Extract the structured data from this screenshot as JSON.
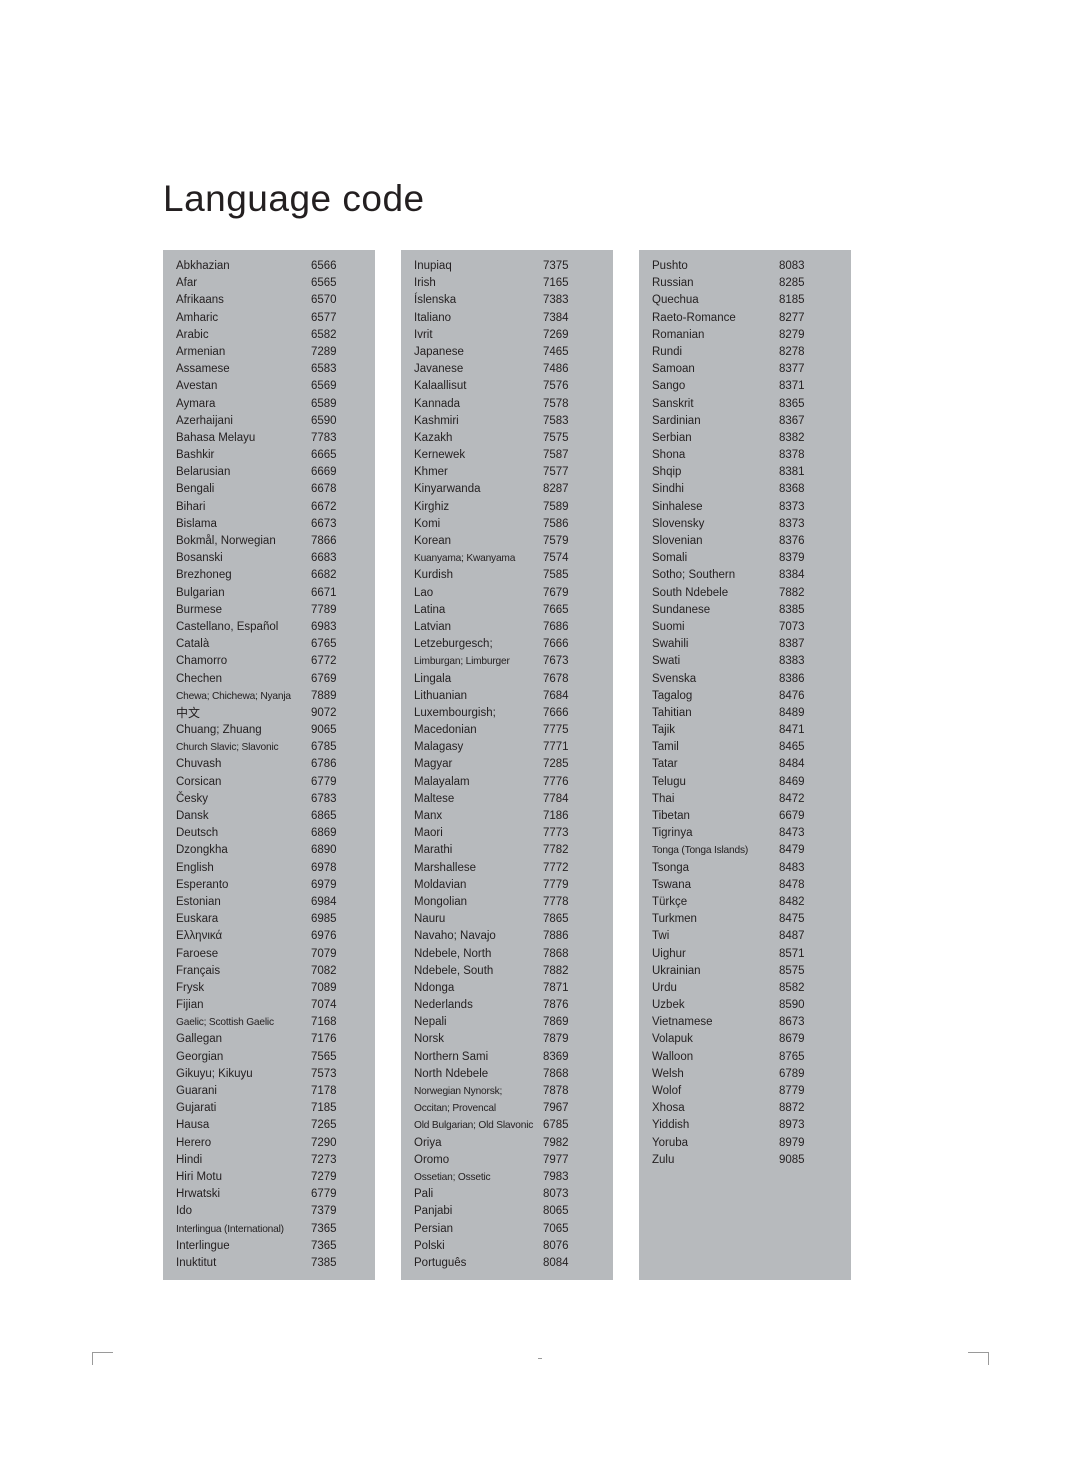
{
  "page": {
    "title": "Language code"
  },
  "columns": [
    {
      "id": "column-1",
      "rows": [
        {
          "lang": "Abkhazian",
          "code": "6566"
        },
        {
          "lang": "Afar",
          "code": "6565"
        },
        {
          "lang": "Afrikaans",
          "code": "6570"
        },
        {
          "lang": "Amharic",
          "code": "6577"
        },
        {
          "lang": "Arabic",
          "code": "6582"
        },
        {
          "lang": "Armenian",
          "code": "7289"
        },
        {
          "lang": "Assamese",
          "code": "6583"
        },
        {
          "lang": "Avestan",
          "code": "6569"
        },
        {
          "lang": "Aymara",
          "code": "6589"
        },
        {
          "lang": "Azerhaijani",
          "code": "6590"
        },
        {
          "lang": "Bahasa Melayu",
          "code": "7783"
        },
        {
          "lang": "Bashkir",
          "code": "6665"
        },
        {
          "lang": "Belarusian",
          "code": "6669"
        },
        {
          "lang": "Bengali",
          "code": "6678"
        },
        {
          "lang": "Bihari",
          "code": "6672"
        },
        {
          "lang": "Bislama",
          "code": "6673"
        },
        {
          "lang": "Bokmål, Norwegian",
          "code": "7866"
        },
        {
          "lang": "Bosanski",
          "code": "6683"
        },
        {
          "lang": "Brezhoneg",
          "code": "6682"
        },
        {
          "lang": "Bulgarian",
          "code": "6671"
        },
        {
          "lang": "Burmese",
          "code": "7789"
        },
        {
          "lang": "Castellano, Español",
          "code": "6983"
        },
        {
          "lang": "Català",
          "code": "6765"
        },
        {
          "lang": "Chamorro",
          "code": "6772"
        },
        {
          "lang": "Chechen",
          "code": "6769"
        },
        {
          "lang": "Chewa; Chichewa; Nyanja",
          "code": "7889",
          "tight": true
        },
        {
          "lang": "中文",
          "code": "9072",
          "cjk": true
        },
        {
          "lang": "Chuang; Zhuang",
          "code": "9065"
        },
        {
          "lang": "Church Slavic; Slavonic",
          "code": "6785",
          "tight": true
        },
        {
          "lang": "Chuvash",
          "code": "6786"
        },
        {
          "lang": "Corsican",
          "code": "6779"
        },
        {
          "lang": "Česky",
          "code": "6783"
        },
        {
          "lang": "Dansk",
          "code": "6865"
        },
        {
          "lang": "Deutsch",
          "code": "6869"
        },
        {
          "lang": "Dzongkha",
          "code": "6890"
        },
        {
          "lang": "English",
          "code": "6978"
        },
        {
          "lang": "Esperanto",
          "code": "6979"
        },
        {
          "lang": "Estonian",
          "code": "6984"
        },
        {
          "lang": "Euskara",
          "code": "6985"
        },
        {
          "lang": "Ελληνικά",
          "code": "6976"
        },
        {
          "lang": "Faroese",
          "code": "7079"
        },
        {
          "lang": "Français",
          "code": "7082"
        },
        {
          "lang": "Frysk",
          "code": "7089"
        },
        {
          "lang": "Fijian",
          "code": "7074"
        },
        {
          "lang": "Gaelic; Scottish Gaelic",
          "code": "7168",
          "tight": true
        },
        {
          "lang": "Gallegan",
          "code": "7176"
        },
        {
          "lang": "Georgian",
          "code": "7565"
        },
        {
          "lang": "Gikuyu; Kikuyu",
          "code": "7573"
        },
        {
          "lang": "Guarani",
          "code": "7178"
        },
        {
          "lang": "Gujarati",
          "code": "7185"
        },
        {
          "lang": "Hausa",
          "code": "7265"
        },
        {
          "lang": "Herero",
          "code": "7290"
        },
        {
          "lang": "Hindi",
          "code": "7273"
        },
        {
          "lang": "Hiri Motu",
          "code": "7279"
        },
        {
          "lang": "Hrwatski",
          "code": "6779"
        },
        {
          "lang": "Ido",
          "code": "7379"
        },
        {
          "lang": "Interlingua (International)",
          "code": "7365",
          "tight": true
        },
        {
          "lang": "Interlingue",
          "code": "7365"
        },
        {
          "lang": "Inuktitut",
          "code": "7385"
        }
      ]
    },
    {
      "id": "column-2",
      "rows": [
        {
          "lang": "Inupiaq",
          "code": "7375"
        },
        {
          "lang": "Irish",
          "code": "7165"
        },
        {
          "lang": "Íslenska",
          "code": "7383"
        },
        {
          "lang": "Italiano",
          "code": "7384"
        },
        {
          "lang": "Ivrit",
          "code": "7269"
        },
        {
          "lang": "Japanese",
          "code": "7465"
        },
        {
          "lang": "Javanese",
          "code": "7486"
        },
        {
          "lang": "Kalaallisut",
          "code": "7576"
        },
        {
          "lang": "Kannada",
          "code": "7578"
        },
        {
          "lang": "Kashmiri",
          "code": "7583"
        },
        {
          "lang": "Kazakh",
          "code": "7575"
        },
        {
          "lang": "Kernewek",
          "code": "7587"
        },
        {
          "lang": "Khmer",
          "code": "7577"
        },
        {
          "lang": "Kinyarwanda",
          "code": "8287"
        },
        {
          "lang": "Kirghiz",
          "code": "7589"
        },
        {
          "lang": "Komi",
          "code": "7586"
        },
        {
          "lang": "Korean",
          "code": "7579"
        },
        {
          "lang": "Kuanyama; Kwanyama",
          "code": "7574",
          "tight": true
        },
        {
          "lang": "Kurdish",
          "code": "7585"
        },
        {
          "lang": "Lao",
          "code": "7679"
        },
        {
          "lang": "Latina",
          "code": "7665"
        },
        {
          "lang": "Latvian",
          "code": "7686"
        },
        {
          "lang": "Letzeburgesch;",
          "code": "7666"
        },
        {
          "lang": "Limburgan; Limburger",
          "code": "7673",
          "tight": true
        },
        {
          "lang": "Lingala",
          "code": "7678"
        },
        {
          "lang": "Lithuanian",
          "code": "7684"
        },
        {
          "lang": "Luxembourgish;",
          "code": "7666"
        },
        {
          "lang": "Macedonian",
          "code": "7775"
        },
        {
          "lang": "Malagasy",
          "code": "7771"
        },
        {
          "lang": "Magyar",
          "code": "7285"
        },
        {
          "lang": "Malayalam",
          "code": "7776"
        },
        {
          "lang": "Maltese",
          "code": "7784"
        },
        {
          "lang": "Manx",
          "code": "7186"
        },
        {
          "lang": "Maori",
          "code": "7773"
        },
        {
          "lang": "Marathi",
          "code": "7782"
        },
        {
          "lang": "Marshallese",
          "code": "7772"
        },
        {
          "lang": "Moldavian",
          "code": "7779"
        },
        {
          "lang": "Mongolian",
          "code": "7778"
        },
        {
          "lang": "Nauru",
          "code": "7865"
        },
        {
          "lang": "Navaho; Navajo",
          "code": "7886"
        },
        {
          "lang": "Ndebele, North",
          "code": "7868"
        },
        {
          "lang": "Ndebele, South",
          "code": "7882"
        },
        {
          "lang": "Ndonga",
          "code": "7871"
        },
        {
          "lang": "Nederlands",
          "code": "7876"
        },
        {
          "lang": "Nepali",
          "code": "7869"
        },
        {
          "lang": "Norsk",
          "code": "7879"
        },
        {
          "lang": "Northern Sami",
          "code": "8369"
        },
        {
          "lang": "North Ndebele",
          "code": "7868"
        },
        {
          "lang": "Norwegian Nynorsk;",
          "code": "7878",
          "tight": true
        },
        {
          "lang": "Occitan; Provencal",
          "code": "7967",
          "tight": true
        },
        {
          "lang": "Old Bulgarian; Old Slavonic",
          "code": "6785",
          "tight": true
        },
        {
          "lang": "Oriya",
          "code": "7982"
        },
        {
          "lang": "Oromo",
          "code": "7977"
        },
        {
          "lang": "Ossetian; Ossetic",
          "code": "7983",
          "tight": true
        },
        {
          "lang": "Pali",
          "code": "8073"
        },
        {
          "lang": "Panjabi",
          "code": "8065"
        },
        {
          "lang": "Persian",
          "code": "7065"
        },
        {
          "lang": "Polski",
          "code": "8076"
        },
        {
          "lang": "Português",
          "code": "8084"
        }
      ]
    },
    {
      "id": "column-3",
      "rows": [
        {
          "lang": "Pushto",
          "code": "8083"
        },
        {
          "lang": "Russian",
          "code": "8285"
        },
        {
          "lang": "Quechua",
          "code": "8185"
        },
        {
          "lang": "Raeto-Romance",
          "code": "8277"
        },
        {
          "lang": "Romanian",
          "code": "8279"
        },
        {
          "lang": "Rundi",
          "code": "8278"
        },
        {
          "lang": "Samoan",
          "code": "8377"
        },
        {
          "lang": "Sango",
          "code": "8371"
        },
        {
          "lang": "Sanskrit",
          "code": "8365"
        },
        {
          "lang": "Sardinian",
          "code": "8367"
        },
        {
          "lang": "Serbian",
          "code": "8382"
        },
        {
          "lang": "Shona",
          "code": "8378"
        },
        {
          "lang": "Shqip",
          "code": "8381"
        },
        {
          "lang": "Sindhi",
          "code": "8368"
        },
        {
          "lang": "Sinhalese",
          "code": "8373"
        },
        {
          "lang": "Slovensky",
          "code": "8373"
        },
        {
          "lang": "Slovenian",
          "code": "8376"
        },
        {
          "lang": "Somali",
          "code": "8379"
        },
        {
          "lang": "Sotho; Southern",
          "code": "8384"
        },
        {
          "lang": "South Ndebele",
          "code": "7882"
        },
        {
          "lang": "Sundanese",
          "code": "8385"
        },
        {
          "lang": "Suomi",
          "code": "7073"
        },
        {
          "lang": "Swahili",
          "code": "8387"
        },
        {
          "lang": "Swati",
          "code": "8383"
        },
        {
          "lang": "Svenska",
          "code": "8386"
        },
        {
          "lang": "Tagalog",
          "code": "8476"
        },
        {
          "lang": "Tahitian",
          "code": "8489"
        },
        {
          "lang": "Tajik",
          "code": "8471"
        },
        {
          "lang": "Tamil",
          "code": "8465"
        },
        {
          "lang": "Tatar",
          "code": "8484"
        },
        {
          "lang": "Telugu",
          "code": "8469"
        },
        {
          "lang": "Thai",
          "code": "8472"
        },
        {
          "lang": "Tibetan",
          "code": "6679"
        },
        {
          "lang": "Tigrinya",
          "code": "8473"
        },
        {
          "lang": "Tonga (Tonga Islands)",
          "code": "8479",
          "tight": true
        },
        {
          "lang": "Tsonga",
          "code": "8483"
        },
        {
          "lang": "Tswana",
          "code": "8478"
        },
        {
          "lang": "Türkçe",
          "code": "8482"
        },
        {
          "lang": "Turkmen",
          "code": "8475"
        },
        {
          "lang": "Twi",
          "code": "8487"
        },
        {
          "lang": "Uighur",
          "code": "8571"
        },
        {
          "lang": "Ukrainian",
          "code": "8575"
        },
        {
          "lang": "Urdu",
          "code": "8582"
        },
        {
          "lang": "Uzbek",
          "code": "8590"
        },
        {
          "lang": "Vietnamese",
          "code": "8673"
        },
        {
          "lang": "Volapuk",
          "code": "8679"
        },
        {
          "lang": "Walloon",
          "code": "8765"
        },
        {
          "lang": "Welsh",
          "code": "6789"
        },
        {
          "lang": "Wolof",
          "code": "8779"
        },
        {
          "lang": "Xhosa",
          "code": "8872"
        },
        {
          "lang": "Yiddish",
          "code": "8973"
        },
        {
          "lang": "Yoruba",
          "code": "8979"
        },
        {
          "lang": "Zulu",
          "code": "9085"
        }
      ]
    }
  ]
}
